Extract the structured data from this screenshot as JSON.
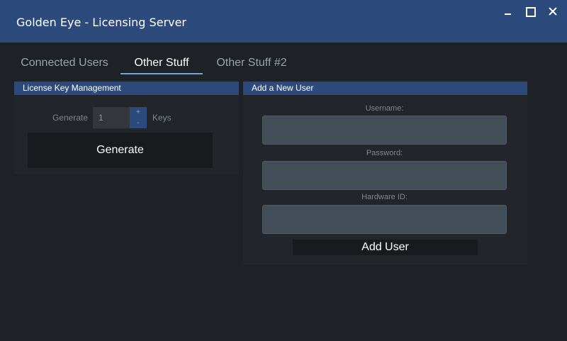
{
  "window": {
    "title": "Golden Eye - Licensing Server"
  },
  "tabs": [
    {
      "label": "Connected Users",
      "active": false
    },
    {
      "label": "Other Stuff",
      "active": true
    },
    {
      "label": "Other Stuff #2",
      "active": false
    }
  ],
  "license_panel": {
    "header": "License Key Management",
    "generate_label": "Generate",
    "count_value": "1",
    "spin_up": "+",
    "spin_down": "-",
    "keys_label": "Keys",
    "generate_button": "Generate"
  },
  "user_panel": {
    "header": "Add a New User",
    "username_label": "Username:",
    "password_label": "Password:",
    "hardware_label": "Hardware ID:",
    "username_value": "",
    "password_value": "",
    "hardware_value": "",
    "add_button": "Add User"
  },
  "colors": {
    "accent": "#2c4a7c",
    "background": "#1e2126",
    "tab_underline": "#6aa8d8"
  }
}
